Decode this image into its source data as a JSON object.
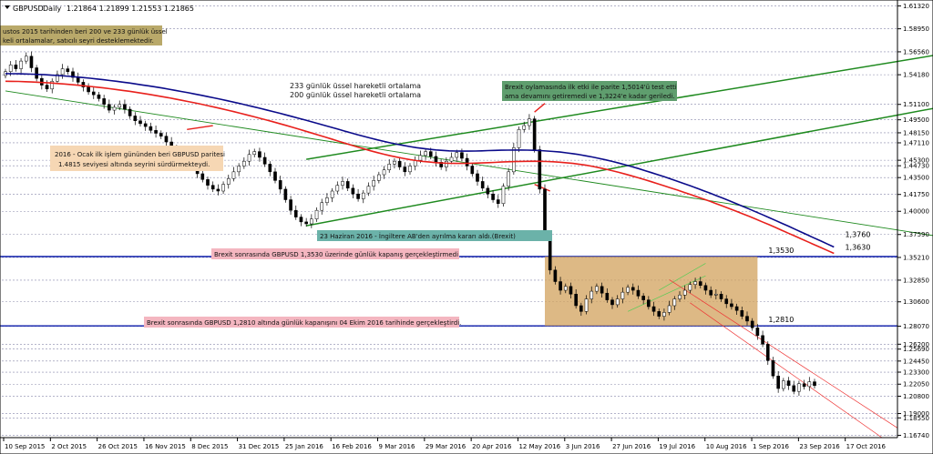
{
  "header": {
    "symbol": "GBPUSD",
    "timeframe": "Daily",
    "ohlc": "1.21864 1.21899 1.21553 1.21865"
  },
  "colors": {
    "bull": "#000000",
    "bear": "#000000",
    "ma200": "#e8201c",
    "ma233": "#0a0a8a",
    "channel": "#1f8a1f",
    "level": "#0a1aa8",
    "box": "#d2a15c",
    "grid": "#8888aa"
  },
  "chart_data": {
    "type": "candlestick",
    "x_ticks": [
      "10 Sep 2015",
      "2 Oct 2015",
      "26 Oct 2015",
      "16 Nov 2015",
      "8 Dec 2015",
      "31 Dec 2015",
      "25 Jan 2016",
      "16 Feb 2016",
      "9 Mar 2016",
      "29 Mar 2016",
      "20 Apr 2016",
      "12 May 2016",
      "3 Jun 2016",
      "27 Jun 2016",
      "19 Jul 2016",
      "10 Aug 2016",
      "1 Sep 2016",
      "23 Sep 2016",
      "17 Oct 2016"
    ],
    "y_ticks": [
      "1.61320",
      "1.58950",
      "1.56560",
      "1.54180",
      "1.51100",
      "1.49500",
      "1.48150",
      "1.47110",
      "1.45300",
      "1.44730",
      "1.43500",
      "1.41750",
      "1.40000",
      "1.37590",
      "1.35210",
      "1.32850",
      "1.30600",
      "1.28070",
      "1.26200",
      "1.25690",
      "1.24450",
      "1.23300",
      "1.22050",
      "1.20800",
      "1.19000",
      "1.18550",
      "1.16740"
    ],
    "ylim": [
      1.165,
      1.6175
    ],
    "closes": [
      1.545,
      1.552,
      1.548,
      1.556,
      1.561,
      1.549,
      1.538,
      1.531,
      1.527,
      1.535,
      1.542,
      1.548,
      1.545,
      1.539,
      1.534,
      1.529,
      1.524,
      1.521,
      1.517,
      1.511,
      1.505,
      1.508,
      1.511,
      1.506,
      1.499,
      1.494,
      1.491,
      1.488,
      1.484,
      1.481,
      1.478,
      1.472,
      1.466,
      1.461,
      1.457,
      1.452,
      1.445,
      1.439,
      1.433,
      1.427,
      1.423,
      1.421,
      1.428,
      1.434,
      1.441,
      1.447,
      1.452,
      1.459,
      1.462,
      1.456,
      1.449,
      1.441,
      1.432,
      1.423,
      1.412,
      1.401,
      1.394,
      1.389,
      1.387,
      1.392,
      1.401,
      1.409,
      1.414,
      1.421,
      1.427,
      1.431,
      1.424,
      1.418,
      1.413,
      1.419,
      1.426,
      1.432,
      1.438,
      1.443,
      1.449,
      1.452,
      1.446,
      1.441,
      1.447,
      1.453,
      1.458,
      1.462,
      1.457,
      1.451,
      1.446,
      1.452,
      1.456,
      1.461,
      1.455,
      1.447,
      1.439,
      1.431,
      1.424,
      1.418,
      1.412,
      1.408,
      1.426,
      1.441,
      1.466,
      1.485,
      1.489,
      1.496,
      1.464,
      1.423,
      1.373,
      1.339,
      1.327,
      1.318,
      1.322,
      1.314,
      1.302,
      1.296,
      1.309,
      1.317,
      1.322,
      1.315,
      1.308,
      1.303,
      1.309,
      1.316,
      1.321,
      1.318,
      1.312,
      1.308,
      1.301,
      1.296,
      1.291,
      1.295,
      1.302,
      1.309,
      1.313,
      1.318,
      1.324,
      1.327,
      1.323,
      1.318,
      1.313,
      1.314,
      1.309,
      1.304,
      1.301,
      1.297,
      1.291,
      1.286,
      1.279,
      1.271,
      1.262,
      1.245,
      1.229,
      1.216,
      1.224,
      1.219,
      1.213,
      1.221,
      1.218,
      1.223,
      1.219
    ],
    "series": [
      {
        "name": "200 günlük üssel hareketli ortalama",
        "values": [
          1.535,
          1.5349,
          1.5348,
          1.5346,
          1.5343,
          1.534,
          1.5336,
          1.5332,
          1.5327,
          1.5322,
          1.5316,
          1.531,
          1.5303,
          1.5296,
          1.5289,
          1.5281,
          1.5273,
          1.5264,
          1.5255,
          1.5246,
          1.5236,
          1.5225,
          1.5214,
          1.5203,
          1.5191,
          1.5179,
          1.5166,
          1.5153,
          1.514,
          1.5126,
          1.5112,
          1.5097,
          1.5082,
          1.5067,
          1.5051,
          1.5035,
          1.5018,
          1.5001,
          1.4984,
          1.4966,
          1.4948,
          1.493,
          1.4911,
          1.4892,
          1.4872,
          1.4852,
          1.4832,
          1.4812,
          1.4791,
          1.4771,
          1.475,
          1.4729,
          1.4708,
          1.4687,
          1.4667,
          1.4647,
          1.4628,
          1.461,
          1.4593,
          1.4577,
          1.4562,
          1.4549,
          1.4537,
          1.4527,
          1.4518,
          1.4511,
          1.4505,
          1.4501,
          1.4498,
          1.4497,
          1.4497,
          1.4498,
          1.45,
          1.4502,
          1.4505,
          1.4508,
          1.4511,
          1.4514,
          1.4516,
          1.4518,
          1.4519,
          1.452,
          1.4519,
          1.4517,
          1.4514,
          1.451,
          1.4504,
          1.4497,
          1.4488,
          1.4478,
          1.4466,
          1.4453,
          1.4438,
          1.4422,
          1.4405,
          1.4387,
          1.4368,
          1.4348,
          1.4328,
          1.4307,
          1.4286,
          1.4264,
          1.4242,
          1.422,
          1.4197,
          1.4174,
          1.4151,
          1.4127,
          1.4103,
          1.4078,
          1.4053,
          1.4027,
          1.4001,
          1.3974,
          1.3947,
          1.3919,
          1.3891,
          1.3862,
          1.3833,
          1.3803,
          1.3773,
          1.3743,
          1.3713,
          1.3683,
          1.3653,
          1.3623,
          1.3593,
          1.3563
        ]
      },
      {
        "name": "233 günlük üssel hareketli ortalama",
        "values": [
          1.543,
          1.5429,
          1.5428,
          1.5426,
          1.5424,
          1.5421,
          1.5418,
          1.5414,
          1.541,
          1.5405,
          1.54,
          1.5394,
          1.5388,
          1.5381,
          1.5374,
          1.5366,
          1.5358,
          1.535,
          1.5341,
          1.5332,
          1.5322,
          1.5312,
          1.5302,
          1.5291,
          1.528,
          1.5268,
          1.5256,
          1.5244,
          1.5231,
          1.5218,
          1.5205,
          1.5191,
          1.5177,
          1.5163,
          1.5148,
          1.5133,
          1.5118,
          1.5102,
          1.5086,
          1.507,
          1.5053,
          1.5036,
          1.5019,
          1.5001,
          1.4983,
          1.4965,
          1.4947,
          1.4928,
          1.4909,
          1.489,
          1.4871,
          1.4852,
          1.4833,
          1.4814,
          1.4795,
          1.4777,
          1.4759,
          1.4742,
          1.4726,
          1.4711,
          1.4697,
          1.4684,
          1.4672,
          1.4661,
          1.4652,
          1.4644,
          1.4637,
          1.4632,
          1.4628,
          1.4626,
          1.4625,
          1.4625,
          1.4626,
          1.4628,
          1.463,
          1.4632,
          1.4634,
          1.4635,
          1.4636,
          1.4636,
          1.4635,
          1.4633,
          1.463,
          1.4626,
          1.4621,
          1.4615,
          1.4607,
          1.4598,
          1.4588,
          1.4576,
          1.4563,
          1.4549,
          1.4534,
          1.4518,
          1.4501,
          1.4483,
          1.4464,
          1.4444,
          1.4423,
          1.4402,
          1.438,
          1.4358,
          1.4335,
          1.4312,
          1.4288,
          1.4264,
          1.4239,
          1.4214,
          1.4188,
          1.4162,
          1.4135,
          1.4108,
          1.408,
          1.4052,
          1.4024,
          1.3995,
          1.3966,
          1.3936,
          1.3906,
          1.3876,
          1.3846,
          1.3815,
          1.3784,
          1.3753,
          1.3722,
          1.3691,
          1.366,
          1.3629
        ]
      }
    ],
    "levels": [
      {
        "value": 1.353,
        "label": "1,3530"
      },
      {
        "value": 1.281,
        "label": "1,2810"
      }
    ],
    "end_labels": [
      {
        "value": 1.376,
        "label": "1,3760"
      },
      {
        "value": 1.363,
        "label": "1,3630"
      }
    ],
    "legend": {
      "ma233": "233 günlük üssel hareketli ortalama",
      "ma200": "200 günlük üssel hareketli ortalama"
    },
    "annotations": {
      "a1_line1": "ustos 2015 tarihinden beri 200 ve 233 günlük üssel",
      "a1_line2": "keli ortalamalar, satıcılı seyri desteklemektedir.",
      "a2_line1": "2016 - Ocak ilk işlem gününden beri GBPUSD paritesi",
      "a2_line2": "1.4815 seviyesi altında seyrini sürdürmekteydi.",
      "a3_line1": "Brexit oylamasında ilk etki ile parite 1,5014'ü test etti",
      "a3_line2": "ama devamını getiremedi ve 1,3224'e kadar geriledi.",
      "a4": "23 Haziran 2016 - İngiltere AB'den ayrılma kararı aldı.(Brexit)",
      "a5": "Brexit sonrasında GBPUSD 1,3530 üzerinde günlük kapanış gerçekleştirmedi",
      "a6": "Brexit sonrasında GBPUSD 1,2810 altında günlük kapanışını 04 Ekim 2016 tarihinde gerçekleştirdi."
    }
  }
}
